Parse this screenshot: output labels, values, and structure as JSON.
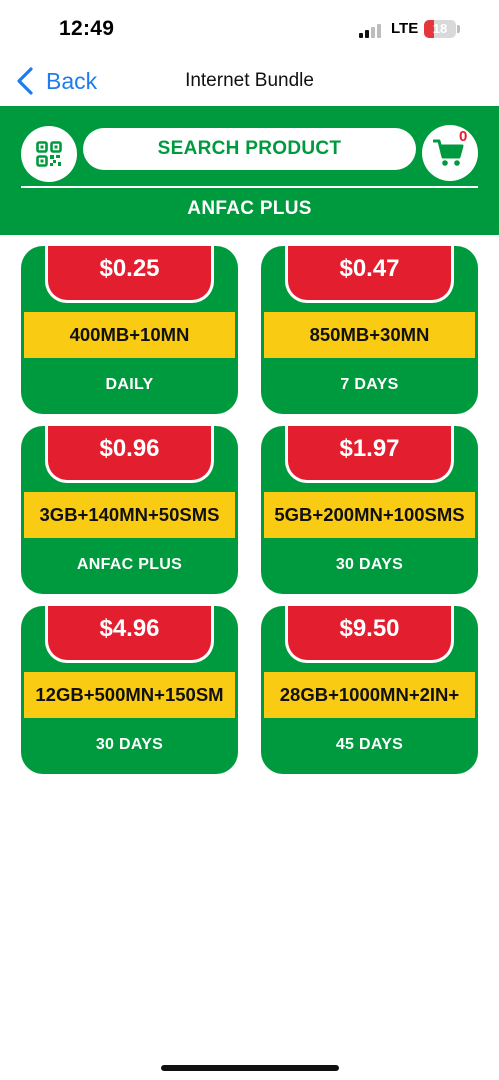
{
  "status_bar": {
    "time": "12:49",
    "network": "LTE",
    "battery": "18"
  },
  "nav": {
    "back_label": "Back",
    "title": "Internet Bundle"
  },
  "header": {
    "search_label": "SEARCH PRODUCT",
    "cart_count": "0",
    "category": "ANFAC PLUS"
  },
  "products": [
    {
      "price": "$0.25",
      "bundle": "400MB+10MN",
      "validity": "DAILY"
    },
    {
      "price": "$0.47",
      "bundle": "850MB+30MN",
      "validity": "7 DAYS"
    },
    {
      "price": "$0.96",
      "bundle": "3GB+140MN+50SMS",
      "validity": "ANFAC PLUS"
    },
    {
      "price": "$1.97",
      "bundle": "5GB+200MN+100SMS",
      "validity": "30 DAYS"
    },
    {
      "price": "$4.96",
      "bundle": "12GB+500MN+150SM",
      "validity": "30 DAYS"
    },
    {
      "price": "$9.50",
      "bundle": "28GB+1000MN+2IN+",
      "validity": "45 DAYS"
    }
  ],
  "colors": {
    "brand_green": "#009a3e",
    "price_red": "#e31e2f",
    "bundle_yellow": "#f9cc13",
    "link_blue": "#1e7cf0"
  }
}
